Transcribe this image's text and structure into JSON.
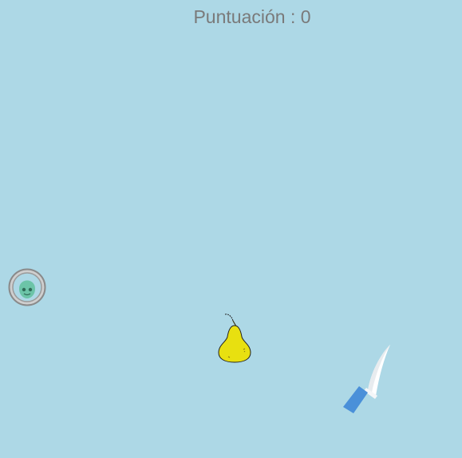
{
  "hud": {
    "score_label": "Puntuación",
    "separator": " : ",
    "score_value": "0"
  },
  "sprites": {
    "monster_icon": "green-alien-in-bubble",
    "fruit_icon": "yellow-pear",
    "blade_icon": "kitchen-knife"
  },
  "colors": {
    "background": "#add8e6",
    "score_text": "#7a7a7a",
    "pear": "#e8e010",
    "knife_handle": "#4a90d9",
    "monster": "#6cc4a8"
  }
}
